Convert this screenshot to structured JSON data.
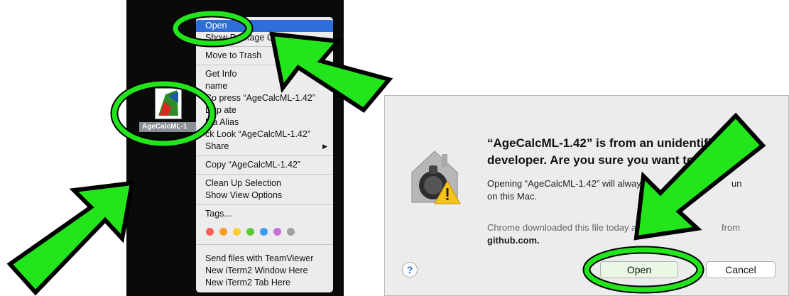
{
  "finder": {
    "app_icon_label": "AgeCalcML-1",
    "context_menu": {
      "items": [
        {
          "label": "Open",
          "highlighted": true
        },
        {
          "label": "Show Package C"
        },
        {
          "label": "Move to Trash"
        },
        {
          "label": "Get Info"
        },
        {
          "label": "name"
        },
        {
          "label": "Co  press “AgeCalcML-1.42”"
        },
        {
          "label": "Dup  ate"
        },
        {
          "label": "Ma  Alias"
        },
        {
          "label": "ck Look “AgeCalcML-1.42”"
        },
        {
          "label": "Share",
          "submenu": "▶"
        },
        {
          "label": "Copy “AgeCalcML-1.42”"
        },
        {
          "label": "Clean Up Selection"
        },
        {
          "label": "Show View Options"
        },
        {
          "label": "Tags..."
        },
        {
          "label": "Send files with TeamViewer"
        },
        {
          "label": "New iTerm2 Window Here"
        },
        {
          "label": "New iTerm2 Tab Here"
        }
      ],
      "tag_colors": [
        "#fc5f57",
        "#fd9a2a",
        "#fdd02f",
        "#5cc93b",
        "#3a9cfb",
        "#c670d8",
        "#a0a0a0"
      ]
    }
  },
  "dialog": {
    "title_line1": "“AgeCalcML-1.42” is from an unidentifi",
    "title_line2": "developer. Are you sure you want to",
    "message_line1": "Opening “AgeCalcML-1.42” will alway",
    "message_line1_tail": "un",
    "message_line2": "on this Mac.",
    "download_line1": "Chrome downloaded this file today a",
    "download_line1_tail": "from",
    "download_line2": "github.com.",
    "help_label": "?",
    "open_label": "Open",
    "cancel_label": "Cancel"
  },
  "annotation_colors": {
    "highlight": "#22e51c",
    "outline": "#000000"
  }
}
